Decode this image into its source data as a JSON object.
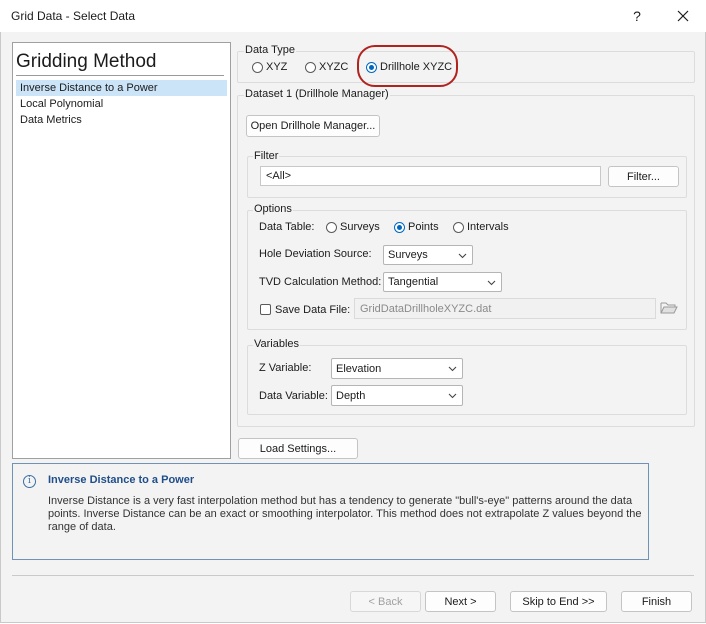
{
  "window": {
    "title": "Grid Data - Select Data",
    "help_label": "?",
    "close_label": "✕"
  },
  "methods": {
    "heading": "Gridding Method",
    "items": [
      {
        "label": "Inverse Distance to a Power",
        "selected": true
      },
      {
        "label": "Local Polynomial",
        "selected": false
      },
      {
        "label": "Data Metrics",
        "selected": false
      }
    ]
  },
  "data_type": {
    "label": "Data Type",
    "options": [
      {
        "label": "XYZ",
        "selected": false
      },
      {
        "label": "XYZC",
        "selected": false
      },
      {
        "label": "Drillhole XYZC",
        "selected": true
      }
    ],
    "highlight_color": "#b02420"
  },
  "dataset": {
    "label": "Dataset 1 (Drillhole Manager)",
    "open_button": "Open Drillhole Manager..."
  },
  "filter": {
    "label": "Filter",
    "value": "<All>",
    "button": "Filter..."
  },
  "options": {
    "label": "Options",
    "data_table_label": "Data Table:",
    "data_table_options": [
      {
        "label": "Surveys",
        "selected": false
      },
      {
        "label": "Points",
        "selected": true
      },
      {
        "label": "Intervals",
        "selected": false
      }
    ],
    "hole_deviation_label": "Hole Deviation Source:",
    "hole_deviation_value": "Surveys",
    "tvd_label": "TVD Calculation Method:",
    "tvd_value": "Tangential",
    "save_data_label": "Save Data File:",
    "save_data_value": "GridDataDrillholeXYZC.dat",
    "save_data_checked": false
  },
  "variables": {
    "label": "Variables",
    "z_label": "Z Variable:",
    "z_value": "Elevation",
    "data_label": "Data Variable:",
    "data_value": "Depth"
  },
  "load_settings": "Load Settings...",
  "info": {
    "icon": "info-icon",
    "title": "Inverse Distance to a Power",
    "text": "Inverse Distance is a very fast interpolation method but has a tendency to generate \"bull's-eye\" patterns around the data points. Inverse Distance can be an exact or smoothing interpolator. This method does not extrapolate Z values beyond the range of data."
  },
  "footer": {
    "back": "< Back",
    "next": "Next >",
    "skip": "Skip to End >>",
    "finish": "Finish"
  },
  "colors": {
    "accent": "#0067c0",
    "selection": "#cce4f7",
    "info_border": "#6f93b8",
    "info_title": "#1f4e8a"
  }
}
